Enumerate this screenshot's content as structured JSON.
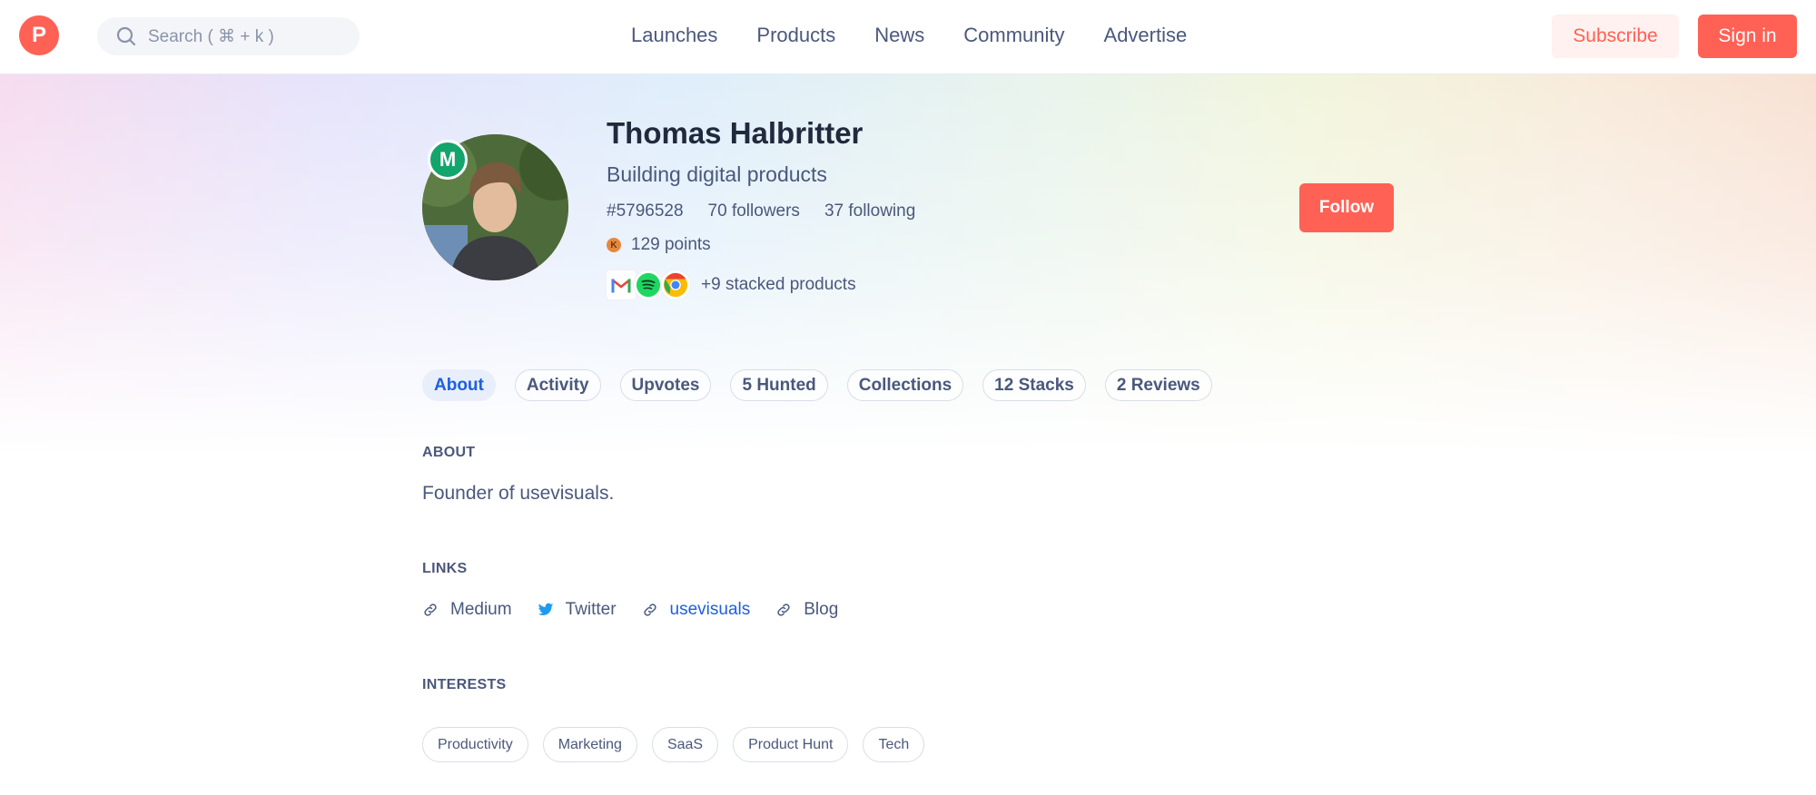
{
  "header": {
    "logo_letter": "P",
    "search_placeholder": "Search ( ⌘ + k )",
    "nav": [
      "Launches",
      "Products",
      "News",
      "Community",
      "Advertise"
    ],
    "subscribe_label": "Subscribe",
    "signin_label": "Sign in"
  },
  "profile": {
    "badge_letter": "M",
    "name": "Thomas Halbritter",
    "headline": "Building digital products",
    "user_id": "#5796528",
    "followers": "70 followers",
    "following": "37 following",
    "points_badge": "K",
    "points": "129 points",
    "stacked_icons": [
      "gmail-icon",
      "spotify-icon",
      "chrome-icon"
    ],
    "stacked_text": "+9 stacked products",
    "follow_label": "Follow"
  },
  "tabs": [
    "About",
    "Activity",
    "Upvotes",
    "5 Hunted",
    "Collections",
    "12 Stacks",
    "2 Reviews"
  ],
  "about": {
    "title": "ABOUT",
    "text": "Founder of usevisuals."
  },
  "links": {
    "title": "LINKS",
    "items": [
      {
        "label": "Medium",
        "icon": "link-icon"
      },
      {
        "label": "Twitter",
        "icon": "twitter-icon"
      },
      {
        "label": "usevisuals",
        "icon": "link-icon"
      },
      {
        "label": "Blog",
        "icon": "link-icon"
      }
    ]
  },
  "interests": {
    "title": "INTERESTS",
    "items": [
      "Productivity",
      "Marketing",
      "SaaS",
      "Product Hunt",
      "Tech"
    ]
  },
  "colors": {
    "brand": "#ff6154",
    "link_blue": "#1c5fe3",
    "text": "#4b587c",
    "heading": "#21293c"
  }
}
